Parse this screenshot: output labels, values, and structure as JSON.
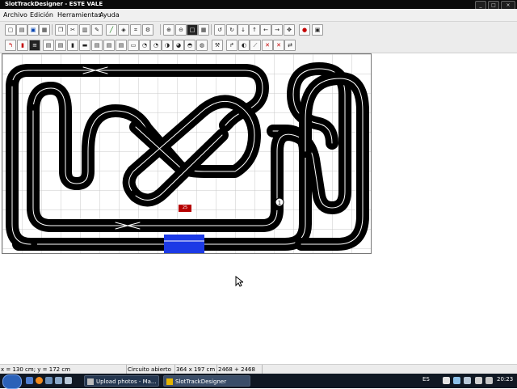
{
  "window": {
    "title": "SlotTrackDesigner - ESTE VALE",
    "controls": [
      "minimize",
      "maximize",
      "close"
    ]
  },
  "menu": {
    "items": [
      "Archivo",
      "Edición",
      "Herramientas",
      "Ayuda"
    ]
  },
  "toolbar1": {
    "buttons": [
      "new-icon",
      "open-icon",
      "save-icon",
      "print-icon",
      "copy-icon",
      "cut-icon",
      "paste-icon",
      "edit-icon",
      "ruler-icon",
      "palette-icon",
      "grid-icon",
      "zoom-in-icon",
      "zoom-out-icon",
      "zoom-window-icon",
      "grid-toggle-icon",
      "rotate-left-icon",
      "rotate-right-icon",
      "arrow-down-icon",
      "arrow-up-icon",
      "arrow-left-icon",
      "arrow-right-icon",
      "move-icon",
      "color-icon",
      "settings-icon"
    ]
  },
  "toolbar2": {
    "buttons": [
      "straight-track-icon",
      "lane-change-icon",
      "straight-short-icon",
      "straight-half-icon",
      "straight-third-icon",
      "straight-quarter-icon",
      "crossover-icon",
      "borders-icon",
      "barrier-icon",
      "curve-1-icon",
      "curve-2-icon",
      "curve-3-icon",
      "curve-4-icon",
      "curve-5-icon",
      "chicane-icon",
      "hairpin-icon",
      "pit-icon",
      "start-icon",
      "banked-icon",
      "curve-right-icon",
      "curve-left-icon",
      "bridge-icon",
      "delete-icon",
      "undo-icon"
    ]
  },
  "canvas": {
    "piece_label": "25",
    "start_piece_number": "1",
    "colors": {
      "track": "#000000",
      "lane_line": "#ffffff",
      "grid": "#c9c9c9",
      "selected_piece": "#1c3ae6",
      "highlight": "#b60000"
    }
  },
  "status": {
    "coords": "x = 130 cm; y = 172 cm",
    "circuit_state": "Circuito abierto",
    "dimensions": "364 x 197 cm",
    "area": "2468 + 2468 cm"
  },
  "taskbar": {
    "tasks": [
      "Upload photos - Ma...",
      "SlotTrackDesigner"
    ],
    "language": "ES",
    "time": "20:23"
  }
}
